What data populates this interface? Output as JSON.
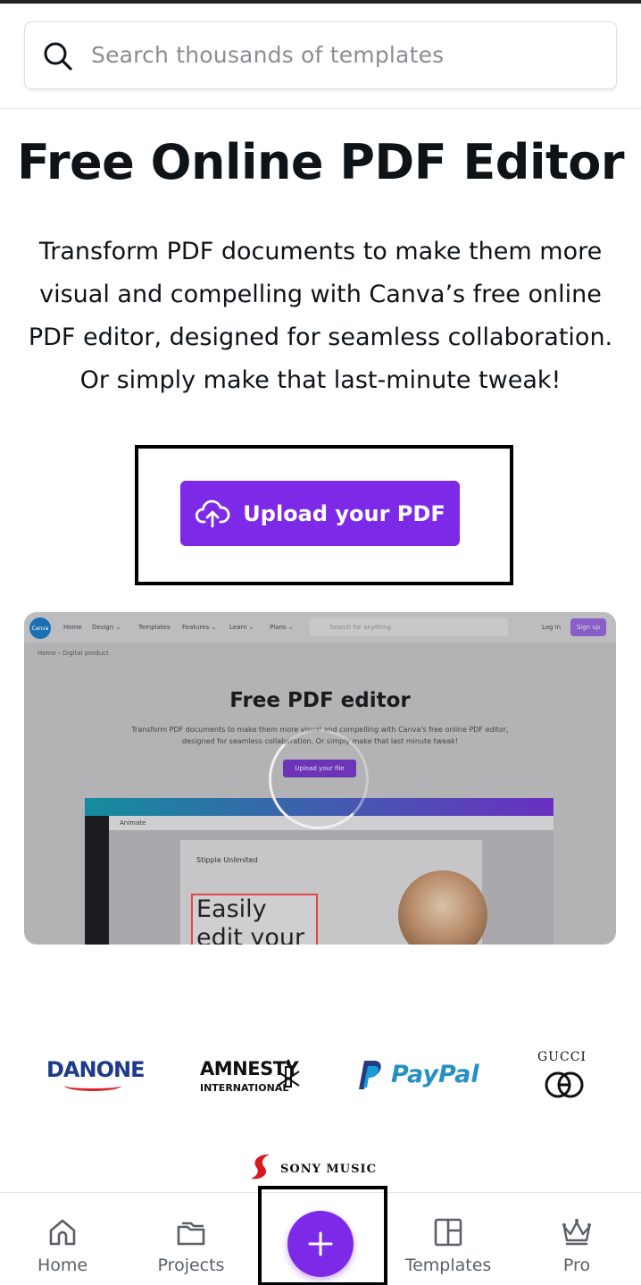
{
  "search": {
    "placeholder": "Search thousands of templates"
  },
  "hero": {
    "title": "Free Online PDF Editor",
    "description": "Transform PDF documents to make them more visual and compelling with Canva’s free online PDF editor, designed for seamless collaboration. Or simply make that last-minute tweak!",
    "cta_label": "Upload your PDF"
  },
  "preview": {
    "logo_text": "Canva",
    "nav_items": [
      "Home",
      "Design ⌄",
      "Templates",
      "Features ⌄",
      "Learn ⌄",
      "Plans ⌄"
    ],
    "search_placeholder": "Search for anything",
    "login": "Log in",
    "signup": "Sign up",
    "breadcrumb": "Home  ›  Digital product",
    "title": "Free PDF editor",
    "description": "Transform PDF documents to make them more visual and compelling with Canva's free online PDF editor, designed for seamless collaboration. Or simply make that last minute tweak!",
    "button": "Upload your file",
    "editor_tool": "Animate",
    "page_brand": "Stipple Unlimited",
    "page_headline": "Easily edit your PDFs"
  },
  "logos": {
    "danone": "DANONE",
    "amnesty_top": "AMNESTY",
    "amnesty_bottom": "INTERNATIONAL",
    "paypal": "PayPal",
    "gucci": "GUCCI",
    "sony": "SONY MUSIC"
  },
  "bottom_nav": {
    "home": "Home",
    "projects": "Projects",
    "templates": "Templates",
    "pro": "Pro"
  },
  "colors": {
    "accent": "#7d2ae8",
    "text": "#0e1318",
    "muted": "#5a5f66"
  }
}
